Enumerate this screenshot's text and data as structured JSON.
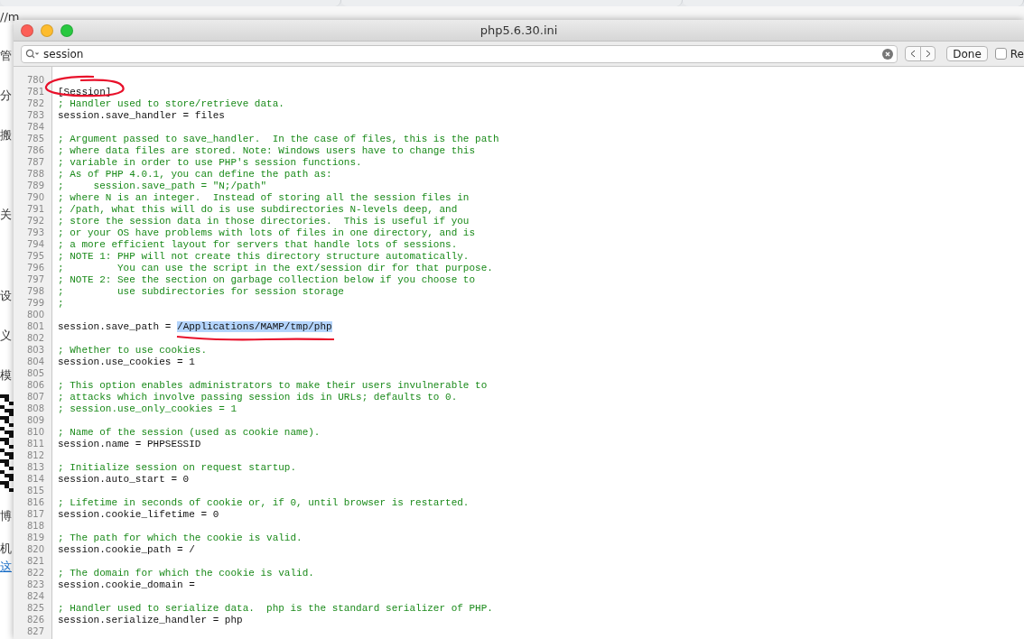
{
  "background_page": {
    "address": "//m",
    "sidebar_texts": [
      {
        "text": "管",
        "kind": "text"
      },
      {
        "text": "分",
        "kind": "text"
      },
      {
        "text": "搬",
        "kind": "text"
      },
      {
        "text": "关",
        "kind": "text"
      },
      {
        "text": "设",
        "kind": "text"
      },
      {
        "text": "义",
        "kind": "text"
      },
      {
        "text": "模",
        "kind": "text"
      },
      {
        "kind": "qr"
      },
      {
        "text": "博",
        "kind": "text"
      },
      {
        "text": "机",
        "kind": "text"
      },
      {
        "text": "这",
        "kind": "link"
      }
    ]
  },
  "window": {
    "title": "php5.6.30.ini"
  },
  "find_bar": {
    "query": "session",
    "done": "Done",
    "option": {
      "label": "Re",
      "checked": false
    }
  },
  "lines": [
    {
      "n": "780",
      "kind": "blank"
    },
    {
      "n": "781",
      "text": "[Session]",
      "kind": "code"
    },
    {
      "n": "782",
      "text": "; Handler used to store/retrieve data.",
      "kind": "comment"
    },
    {
      "n": "783",
      "text": "session.save_handler = files",
      "kind": "code"
    },
    {
      "n": "784",
      "kind": "blank"
    },
    {
      "n": "785",
      "text": "; Argument passed to save_handler.  In the case of files, this is the path",
      "kind": "comment"
    },
    {
      "n": "786",
      "text": "; where data files are stored. Note: Windows users have to change this",
      "kind": "comment"
    },
    {
      "n": "787",
      "text": "; variable in order to use PHP's session functions.",
      "kind": "comment"
    },
    {
      "n": "788",
      "text": "; As of PHP 4.0.1, you can define the path as:",
      "kind": "comment"
    },
    {
      "n": "789",
      "text": ";     session.save_path = \"N;/path\"",
      "kind": "comment"
    },
    {
      "n": "790",
      "text": "; where N is an integer.  Instead of storing all the session files in",
      "kind": "comment"
    },
    {
      "n": "791",
      "text": "; /path, what this will do is use subdirectories N-levels deep, and",
      "kind": "comment"
    },
    {
      "n": "792",
      "text": "; store the session data in those directories.  This is useful if you",
      "kind": "comment"
    },
    {
      "n": "793",
      "text": "; or your OS have problems with lots of files in one directory, and is",
      "kind": "comment"
    },
    {
      "n": "794",
      "text": "; a more efficient layout for servers that handle lots of sessions.",
      "kind": "comment"
    },
    {
      "n": "795",
      "text": "; NOTE 1: PHP will not create this directory structure automatically.",
      "kind": "comment"
    },
    {
      "n": "796",
      "text": ";         You can use the script in the ext/session dir for that purpose.",
      "kind": "comment"
    },
    {
      "n": "797",
      "text": "; NOTE 2: See the section on garbage collection below if you choose to",
      "kind": "comment"
    },
    {
      "n": "798",
      "text": ";         use subdirectories for session storage",
      "kind": "comment"
    },
    {
      "n": "799",
      "text": ";",
      "kind": "comment"
    },
    {
      "n": "800",
      "kind": "blank"
    },
    {
      "n": "801",
      "text": "session.save_path = ",
      "selection": "/Applications/MAMP/tmp/php",
      "kind": "code"
    },
    {
      "n": "802",
      "kind": "blank"
    },
    {
      "n": "803",
      "text": "; Whether to use cookies.",
      "kind": "comment"
    },
    {
      "n": "804",
      "text": "session.use_cookies = 1",
      "kind": "code"
    },
    {
      "n": "805",
      "kind": "blank"
    },
    {
      "n": "806",
      "text": "; This option enables administrators to make their users invulnerable to",
      "kind": "comment"
    },
    {
      "n": "807",
      "text": "; attacks which involve passing session ids in URLs; defaults to 0.",
      "kind": "comment"
    },
    {
      "n": "808",
      "text": "; session.use_only_cookies = 1",
      "kind": "comment"
    },
    {
      "n": "809",
      "kind": "blank"
    },
    {
      "n": "810",
      "text": "; Name of the session (used as cookie name).",
      "kind": "comment"
    },
    {
      "n": "811",
      "text": "session.name = PHPSESSID",
      "kind": "code"
    },
    {
      "n": "812",
      "kind": "blank"
    },
    {
      "n": "813",
      "text": "; Initialize session on request startup.",
      "kind": "comment"
    },
    {
      "n": "814",
      "text": "session.auto_start = 0",
      "kind": "code"
    },
    {
      "n": "815",
      "kind": "blank"
    },
    {
      "n": "816",
      "text": "; Lifetime in seconds of cookie or, if 0, until browser is restarted.",
      "kind": "comment"
    },
    {
      "n": "817",
      "text": "session.cookie_lifetime = 0",
      "kind": "code"
    },
    {
      "n": "818",
      "kind": "blank"
    },
    {
      "n": "819",
      "text": "; The path for which the cookie is valid.",
      "kind": "comment"
    },
    {
      "n": "820",
      "text": "session.cookie_path = /",
      "kind": "code"
    },
    {
      "n": "821",
      "kind": "blank"
    },
    {
      "n": "822",
      "text": "; The domain for which the cookie is valid.",
      "kind": "comment"
    },
    {
      "n": "823",
      "text": "session.cookie_domain =",
      "kind": "code"
    },
    {
      "n": "824",
      "kind": "blank"
    },
    {
      "n": "825",
      "text": "; Handler used to serialize data.  php is the standard serializer of PHP.",
      "kind": "comment"
    },
    {
      "n": "826",
      "text": "session.serialize_handler = php",
      "kind": "code"
    },
    {
      "n": "827",
      "kind": "blank"
    }
  ]
}
